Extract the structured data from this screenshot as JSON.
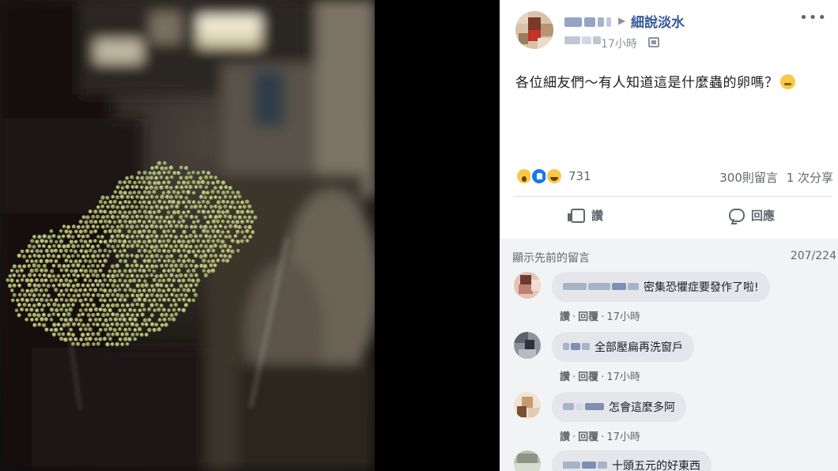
{
  "post": {
    "group_name": "細說淡水",
    "time": "17小時",
    "text": "各位細友們～有人知道這是什麼蟲的卵嗎？",
    "reaction_count": "731",
    "comments_count": "300則留言",
    "shares_count": "1 次分享",
    "actions": {
      "like_label": "讚",
      "comment_label": "回應"
    }
  },
  "comments_section": {
    "show_previous": "顯示先前的留言",
    "count": "207/224",
    "items": [
      {
        "text": "密集恐懼症要發作了啦!",
        "like_label": "讚",
        "reply_label": "回覆",
        "time": "17小時"
      },
      {
        "text": "全部壓扁再洗窗戶",
        "like_label": "讚",
        "reply_label": "回覆",
        "time": "17小時"
      },
      {
        "text": "怎會這麼多阿",
        "like_label": "讚",
        "reply_label": "回覆",
        "time": "17小時"
      },
      {
        "text": "十頭五元的好東西"
      }
    ]
  },
  "icons": {
    "more": "more-options-icon",
    "privacy": "privacy-icon",
    "like": "thumbs-up-icon",
    "comment": "comment-bubble-icon"
  },
  "colors": {
    "facebook_link": "#365899",
    "comment_bubble": "#e4e6eb",
    "egg_cluster": "#b7c47a"
  }
}
